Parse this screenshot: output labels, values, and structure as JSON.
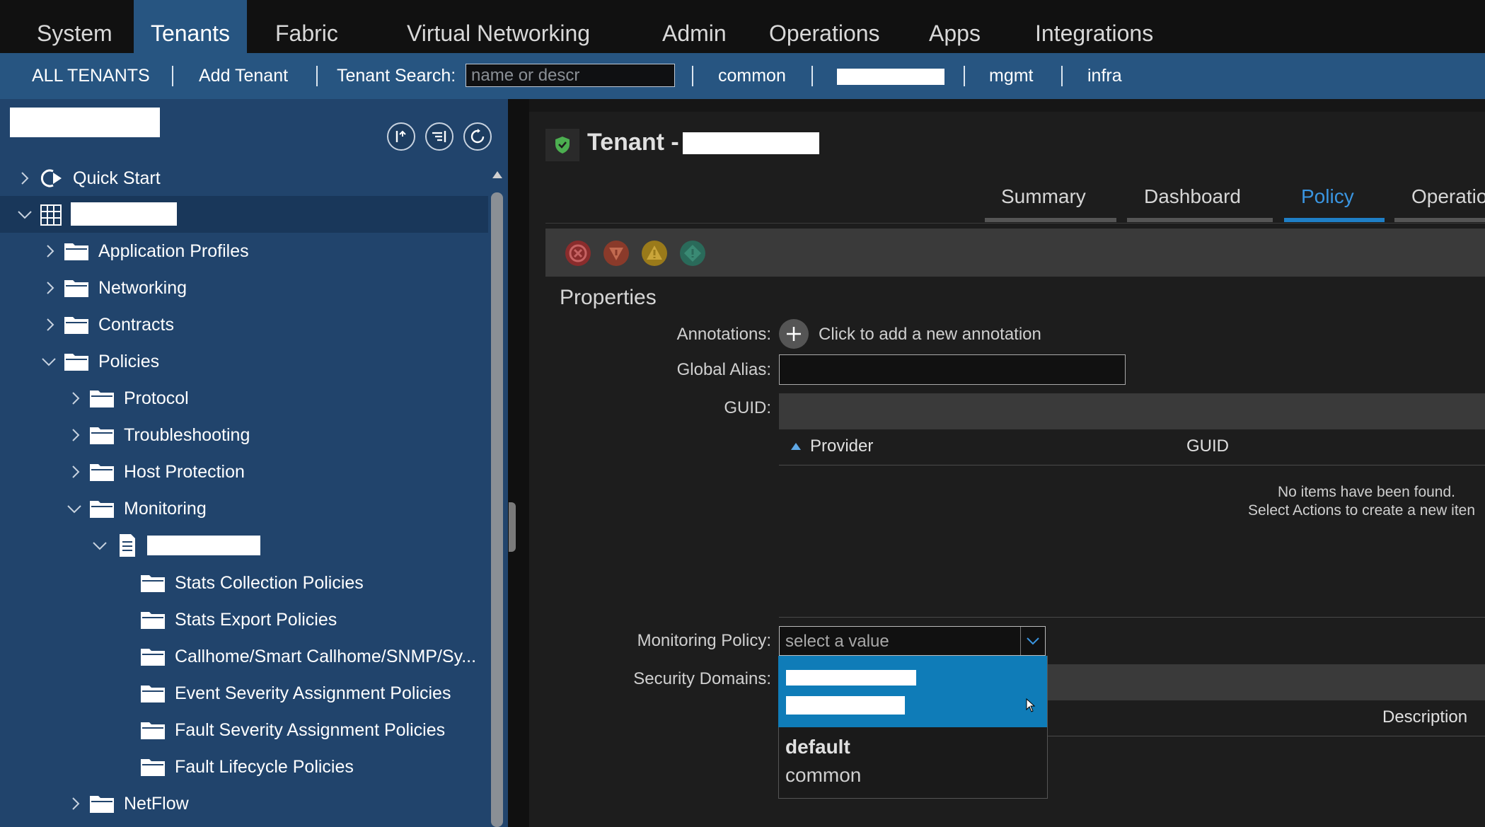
{
  "topmenu": {
    "items": [
      "System",
      "Tenants",
      "Fabric",
      "Virtual Networking",
      "Admin",
      "Operations",
      "Apps",
      "Integrations"
    ],
    "active": "Tenants"
  },
  "subnav": {
    "all_tenants": "ALL TENANTS",
    "add_tenant": "Add Tenant",
    "search_label": "Tenant Search:",
    "search_placeholder": "name or descr",
    "search_value": "",
    "tenants": [
      "common",
      "mgmt",
      "infra"
    ]
  },
  "tree": {
    "quick_start": "Quick Start",
    "application_profiles": "Application Profiles",
    "networking": "Networking",
    "contracts": "Contracts",
    "policies": "Policies",
    "protocol": "Protocol",
    "troubleshooting": "Troubleshooting",
    "host_protection": "Host Protection",
    "monitoring": "Monitoring",
    "stats_collection": "Stats Collection Policies",
    "stats_export": "Stats Export Policies",
    "callhome": "Callhome/Smart Callhome/SNMP/Sy...",
    "event_severity": "Event Severity Assignment Policies",
    "fault_severity": "Fault Severity Assignment Policies",
    "fault_lifecycle": "Fault Lifecycle Policies",
    "netflow": "NetFlow"
  },
  "content": {
    "title_prefix": "Tenant -",
    "tabs": [
      "Summary",
      "Dashboard",
      "Policy",
      "Operatio"
    ],
    "active_tab": "Policy",
    "properties_heading": "Properties",
    "annotations_label": "Annotations:",
    "add_annotation_text": "Click to add a new annotation",
    "global_alias_label": "Global Alias:",
    "global_alias_value": "",
    "guid_label": "GUID:",
    "guid_table": {
      "columns": [
        "Provider",
        "GUID"
      ],
      "empty_line1": "No items have been found.",
      "empty_line2": "Select Actions to create a new iten"
    },
    "monitoring_policy_label": "Monitoring Policy:",
    "monitoring_policy_placeholder": "select a value",
    "security_domains_label": "Security Domains:",
    "security_table_column": "Description",
    "dropdown_options": [
      {
        "name": "",
        "tenant": ""
      },
      {
        "name": "default",
        "tenant": "common"
      }
    ]
  },
  "colors": {
    "accent": "#275581",
    "tab_active": "#1f7fc6",
    "dropdown_highlight": "#0f7cb8",
    "tenant_shield": "#4caf50"
  }
}
